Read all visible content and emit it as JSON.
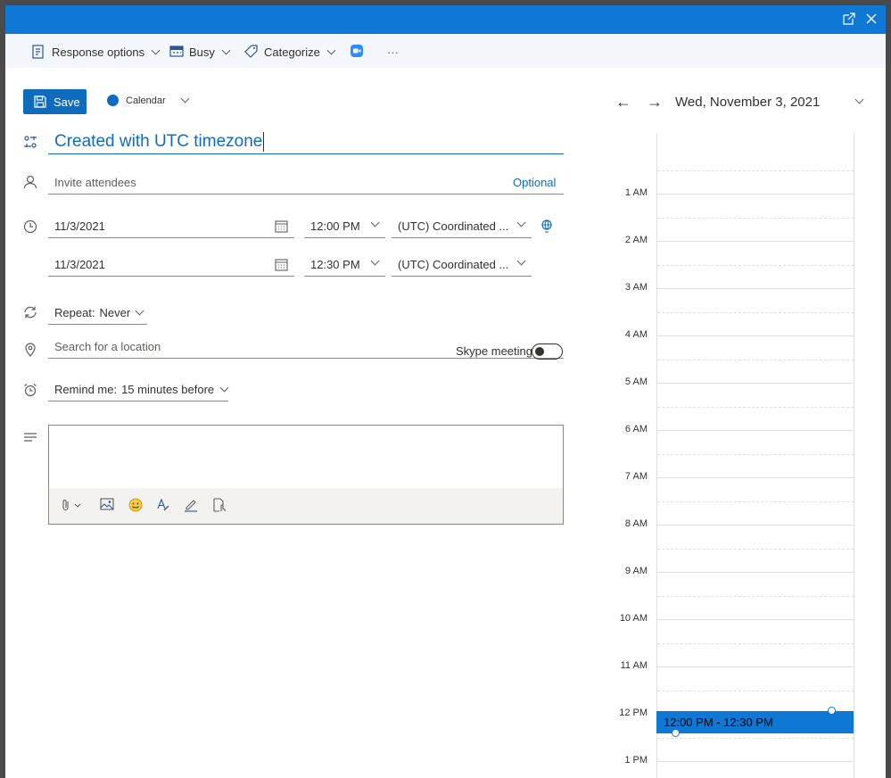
{
  "ribbon": {
    "response_options": "Response options",
    "busy": "Busy",
    "categorize": "Categorize",
    "more": "···"
  },
  "form": {
    "save_label": "Save",
    "calendar_label": "Calendar",
    "title_value": "Created with UTC timezone",
    "attendees_placeholder": "Invite attendees",
    "optional_label": "Optional",
    "start_date": "11/3/2021",
    "start_time": "12:00 PM",
    "start_timezone": "(UTC) Coordinated ...",
    "end_date": "11/3/2021",
    "end_time": "12:30 PM",
    "end_timezone": "(UTC) Coordinated ...",
    "repeat_label": "Repeat:",
    "repeat_value": "Never",
    "location_placeholder": "Search for a location",
    "skype_label": "Skype meeting",
    "skype_enabled": false,
    "remind_label": "Remind me:",
    "remind_value": "15 minutes before"
  },
  "calendar": {
    "date_heading": "Wed, November 3, 2021",
    "hours": [
      "1 AM",
      "2 AM",
      "3 AM",
      "4 AM",
      "5 AM",
      "6 AM",
      "7 AM",
      "8 AM",
      "9 AM",
      "10 AM",
      "11 AM",
      "12 PM",
      "1 PM"
    ],
    "event_label": "12:00 PM - 12:30 PM"
  },
  "colors": {
    "accent": "#0f6cbd",
    "titlebar": "#0f78d4"
  }
}
